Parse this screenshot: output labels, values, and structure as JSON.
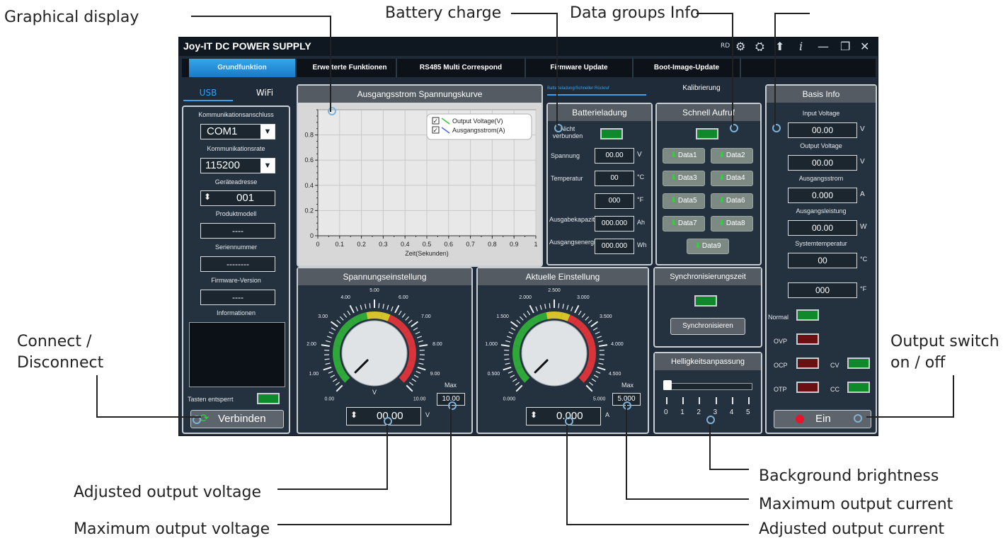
{
  "callouts": {
    "graphical_display": "Graphical display",
    "battery_charge": "Battery charge",
    "data_groups_info": "Data groups Info",
    "connect_disconnect": "Connect /\nDisconnect",
    "output_switch": "Output switch\non / off",
    "background_brightness": "Background brightness",
    "maximum_output_current": "Maximum output current",
    "adjusted_output_current": "Adjusted output current",
    "adjusted_output_voltage": "Adjusted output voltage",
    "maximum_output_voltage": "Maximum output voltage"
  },
  "window": {
    "title": "Joy-IT DC POWER SUPPLY",
    "rd": "RD",
    "icons": [
      "gear-icon",
      "settings2-icon",
      "upload-icon",
      "info-icon",
      "minimize-icon",
      "restore-icon",
      "close-icon"
    ]
  },
  "tabs": [
    {
      "label": "Grundfunktion",
      "active": true
    },
    {
      "label": "Erweiterte Funktionen",
      "active": false
    },
    {
      "label": "RS485 Multi Correspond",
      "active": false
    },
    {
      "label": "Firmware Update",
      "active": false
    },
    {
      "label": "Boot-Image-Update",
      "active": false
    }
  ],
  "left": {
    "usb": "USB",
    "wifi": "WiFi",
    "port_label": "Kommunikationsanschluss",
    "port_value": "COM1",
    "rate_label": "Kommunikationsrate",
    "rate_value": "115200",
    "address_label": "Geräteadresse",
    "address_value": "001",
    "model_label": "Produktmodell",
    "model_value": "----",
    "serial_label": "Seriennummer",
    "serial_value": "--------",
    "fw_label": "Firmware-Version",
    "fw_value": "----",
    "info_label": "Informationen",
    "keys_unlocked": "Tasten entsperrt",
    "connect_button": "Verbinden"
  },
  "chart_panel": {
    "title": "Ausgangsstrom Spannungskurve",
    "legend_voltage": "Output Voltage(V)",
    "legend_current": "Ausgangsstrom(A)",
    "xlabel": "Zeit(Sekunden)"
  },
  "chart_data": {
    "type": "line",
    "title": "Ausgangsstrom Spannungskurve",
    "xlabel": "Zeit(Sekunden)",
    "ylabel": "",
    "x_ticks": [
      "0",
      "0.1",
      "0.2",
      "0.3",
      "0.4",
      "0.5",
      "0.6",
      "0.7",
      "0.8",
      "0.9",
      "1"
    ],
    "y_ticks": [
      "0",
      "0.2",
      "0.4",
      "0.6",
      "0.8"
    ],
    "xlim": [
      0,
      1
    ],
    "ylim": [
      0,
      1
    ],
    "grid": true,
    "legend_placement": "top-right",
    "series": [
      {
        "name": "Output Voltage(V)",
        "values": [],
        "color": "#3cc24a"
      },
      {
        "name": "Ausgangsstrom(A)",
        "values": [],
        "color": "#4a6bd8"
      }
    ]
  },
  "mode_tabs": {
    "battery_fast": "Batterieladung/Schneller Rückruf",
    "calibration": "Kalibrierung"
  },
  "battery": {
    "title": "Batterieladung",
    "not_connected": "Nicht verbunden",
    "voltage_label": "Spannung",
    "voltage_value": "00.00",
    "voltage_unit": "V",
    "temp_label": "Temperatur",
    "temp_c_value": "00",
    "temp_c_unit": "°C",
    "temp_f_value": "000",
    "temp_f_unit": "°F",
    "capacity_label": "Ausgabekapazität",
    "capacity_value": "000.000",
    "capacity_unit": "Ah",
    "energy_label": "Ausgangsenergie",
    "energy_value": "000.000",
    "energy_unit": "Wh"
  },
  "quick_recall": {
    "title": "Schnell Aufruf",
    "buttons": [
      "Data1",
      "Data2",
      "Data3",
      "Data4",
      "Data5",
      "Data6",
      "Data7",
      "Data8",
      "Data9"
    ]
  },
  "voltage_setting": {
    "title": "Spannungseinstellung",
    "scale": [
      "0.00",
      "1.00",
      "2.00",
      "3.00",
      "4.00",
      "5.00",
      "6.00",
      "7.00",
      "8.00",
      "9.00",
      "10.00"
    ],
    "unit_center": "V",
    "max_label": "Max",
    "max_value": "10.00",
    "value": "00.00",
    "unit": "V",
    "dial_fraction": 0.0
  },
  "current_setting": {
    "title": "Aktuelle Einstellung",
    "scale": [
      "0.000",
      "0.500",
      "1.000",
      "1.500",
      "2.000",
      "2.500",
      "3.000",
      "3.500",
      "4.000",
      "4.500",
      "5.000"
    ],
    "max_label": "Max",
    "max_value": "5.000",
    "value": "0.000",
    "unit": "A",
    "dial_fraction": 0.0
  },
  "sync": {
    "title": "Synchronisierungszeit",
    "button": "Synchronisieren"
  },
  "brightness": {
    "title": "Helligkeitsanpassung",
    "ticks": [
      "0",
      "1",
      "2",
      "3",
      "4",
      "5"
    ],
    "level": 0
  },
  "basis": {
    "title": "Basis Info",
    "input_voltage_label": "Input Voltage",
    "input_voltage_value": "00.00",
    "input_voltage_unit": "V",
    "output_voltage_label": "Output Voltage",
    "output_voltage_value": "00.00",
    "output_voltage_unit": "V",
    "output_current_label": "Ausgangsstrom",
    "output_current_value": "0.000",
    "output_current_unit": "A",
    "output_power_label": "Ausgangsleistung",
    "output_power_value": "00.00",
    "output_power_unit": "W",
    "system_temp_label": "Systemtemperatur",
    "system_temp_c_value": "00",
    "system_temp_c_unit": "°C",
    "system_temp_f_value": "000",
    "system_temp_f_unit": "°F",
    "normal": "Normal",
    "ovp": "OVP",
    "ocp": "OCP",
    "otp": "OTP",
    "cv": "CV",
    "cc": "CC",
    "output_button": "Ein"
  }
}
